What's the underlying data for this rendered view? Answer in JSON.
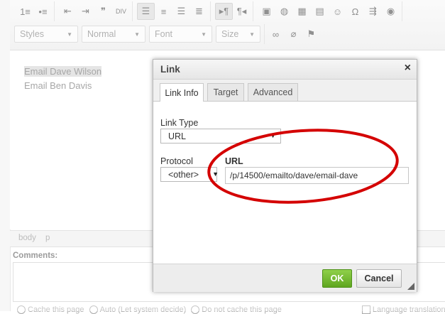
{
  "toolbar": {
    "row1_groups": [
      [
        {
          "icon": "numbered-list-icon",
          "glyph": "1≡"
        },
        {
          "icon": "bulleted-list-icon",
          "glyph": "•≡"
        }
      ],
      [
        {
          "icon": "decrease-indent-icon",
          "glyph": "⇤"
        },
        {
          "icon": "increase-indent-icon",
          "glyph": "⇥"
        },
        {
          "icon": "blockquote-icon",
          "glyph": "❞"
        },
        {
          "icon": "div-container-icon",
          "glyph": "DIV"
        }
      ],
      [
        {
          "icon": "align-left-icon",
          "glyph": "☰",
          "active": true
        },
        {
          "icon": "align-center-icon",
          "glyph": "≡"
        },
        {
          "icon": "align-right-icon",
          "glyph": "☰"
        },
        {
          "icon": "justify-icon",
          "glyph": "≣"
        }
      ],
      [
        {
          "icon": "ltr-direction-icon",
          "glyph": "▸¶",
          "active": true
        },
        {
          "icon": "rtl-direction-icon",
          "glyph": "¶◂"
        }
      ],
      [
        {
          "icon": "image-icon",
          "glyph": "▣"
        },
        {
          "icon": "flash-icon",
          "glyph": "◍"
        },
        {
          "icon": "table-icon",
          "glyph": "▦"
        },
        {
          "icon": "horizontal-line-icon",
          "glyph": "▤"
        },
        {
          "icon": "smiley-icon",
          "glyph": "☺"
        },
        {
          "icon": "special-char-icon",
          "glyph": "Ω"
        },
        {
          "icon": "page-break-icon",
          "glyph": "⇶"
        },
        {
          "icon": "iframe-icon",
          "glyph": "◉"
        }
      ]
    ],
    "styles_label": "Styles",
    "format_label": "Normal",
    "font_label": "Font",
    "size_label": "Size",
    "row2_icons": [
      {
        "icon": "link-icon",
        "glyph": "∞"
      },
      {
        "icon": "unlink-icon",
        "glyph": "⌀"
      },
      {
        "icon": "anchor-flag-icon",
        "glyph": "⚑"
      }
    ]
  },
  "content": {
    "line1": "Email Dave Wilson",
    "line2": "Email Ben Davis"
  },
  "pathbar": {
    "el1": "body",
    "el2": "p"
  },
  "comments_label": "Comments:",
  "bottom_options": [
    "Cache this page",
    "Auto (Let system decide)",
    "Do not cache this page",
    "Language translation"
  ],
  "dialog": {
    "title": "Link",
    "close_glyph": "×",
    "tabs": [
      "Link Info",
      "Target",
      "Advanced"
    ],
    "link_type_label": "Link Type",
    "link_type_value": "URL",
    "protocol_label": "Protocol",
    "protocol_value": "<other>",
    "url_label": "URL",
    "url_value": "/p/14500/emailto/dave/email-dave",
    "ok_label": "OK",
    "cancel_label": "Cancel"
  },
  "colors": {
    "annotation_ellipse": "#d40000",
    "ok_button": "#6db42c"
  }
}
